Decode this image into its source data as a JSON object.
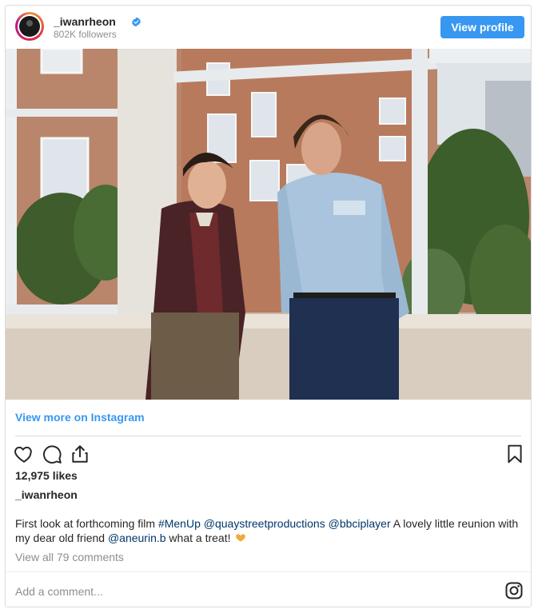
{
  "header": {
    "username": "_iwanrheon",
    "followers": "802K followers",
    "view_profile_label": "View profile",
    "verified_icon": "verified-badge-icon",
    "accent_color": "#3897f0"
  },
  "post": {
    "view_more": "View more on Instagram",
    "likes": "12,975 likes",
    "caption_user": "_iwanrheon",
    "caption_parts": {
      "p1": "First look at forthcoming film ",
      "hashtag": "#MenUp",
      "p2": " ",
      "mention1": "@quaystreetproductions",
      "p3": " ",
      "mention2": "@bbciplayer",
      "p4": " A lovely little reunion with my dear old friend ",
      "mention3": "@aneurin.b",
      "p5": " what a treat! "
    },
    "comments_link": "View all 79 comments",
    "add_comment": "Add a comment...",
    "icons": [
      "heart-icon",
      "comment-icon",
      "share-icon",
      "bookmark-icon",
      "heart-hands-emoji-icon",
      "instagram-icon"
    ]
  }
}
